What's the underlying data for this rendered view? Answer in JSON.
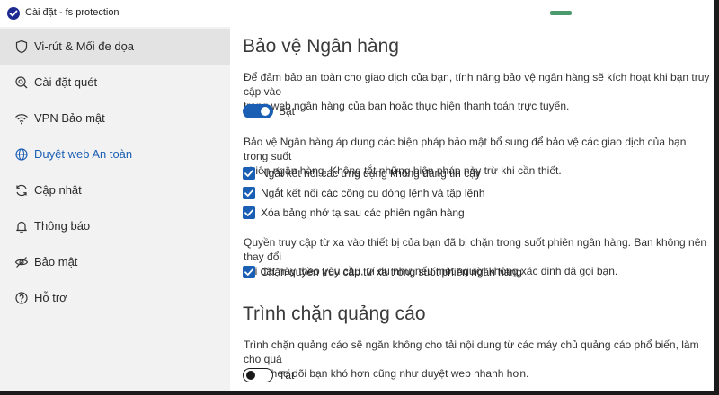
{
  "titlebar": {
    "title": "Cài đặt - fs protection"
  },
  "colors": {
    "accent": "#1a5fb4",
    "sidebar_bg": "#f2f2f2",
    "selected_bg": "#e3e3e3"
  },
  "sidebar": {
    "items": [
      {
        "label": "Vi-rút & Mối đe dọa",
        "icon": "shield-icon",
        "state": "selected"
      },
      {
        "label": "Cài đặt quét",
        "icon": "scan-icon",
        "state": ""
      },
      {
        "label": "VPN Bảo mật",
        "icon": "wifi-icon",
        "state": ""
      },
      {
        "label": "Duyệt web An toàn",
        "icon": "globe-icon",
        "state": "active"
      },
      {
        "label": "Cập nhật",
        "icon": "refresh-icon",
        "state": ""
      },
      {
        "label": "Thông báo",
        "icon": "bell-icon",
        "state": ""
      },
      {
        "label": "Bảo mật",
        "icon": "eye-slash-icon",
        "state": ""
      },
      {
        "label": "Hỗ trợ",
        "icon": "help-icon",
        "state": ""
      }
    ]
  },
  "banking": {
    "title": "Bảo vệ Ngân hàng",
    "description_line1": "Để đảm bảo an toàn cho giao dịch của bạn, tính năng bảo vệ ngân hàng sẽ kích hoạt khi bạn truy cập vào",
    "description_line2": "trang web ngân hàng của bạn hoặc thực hiện thanh toán trực tuyến.",
    "toggle_label": "Bật",
    "toggle_on": true,
    "measures_line1": "Bảo vệ Ngân hàng áp dụng các biện pháp bảo mật bổ sung để bảo vệ các giao dịch của bạn trong suốt",
    "measures_line2": "phiên ngân hàng. Không tắt những biện pháp này trừ khi cần thiết.",
    "options": [
      {
        "label": "Ngắt kết nối các ứng dụng không đáng tin cậy",
        "checked": true
      },
      {
        "label": "Ngắt kết nối các công cụ dòng lệnh và tập lệnh",
        "checked": true
      },
      {
        "label": "Xóa bảng nhớ tạ sau các phiên ngân hàng",
        "checked": true
      }
    ],
    "remote_line1": "Quyền truy cập từ xa vào thiết bị của bạn đã bị chặn trong suốt phiên ngân hàng. Bạn không nên thay đổi",
    "remote_line2": "cài đặt này theo yêu cầu, ví dụ như nếu một người không xác định đã gọi bạn.",
    "remote_option": {
      "label": "Chặn quyền truy cập từ xa trong suốt phiên ngân hàng",
      "checked": true
    }
  },
  "adblock": {
    "title": "Trình chặn quảng cáo",
    "description_line1": "Trình chặn quảng cáo sẽ ngăn không cho tải nội dung từ các máy chủ quảng cáo phổ biến, làm cho quá",
    "description_line2": "trình theo dõi bạn khó hơn cũng như duyệt web nhanh hơn.",
    "toggle_label": "Tắt",
    "toggle_on": false
  }
}
